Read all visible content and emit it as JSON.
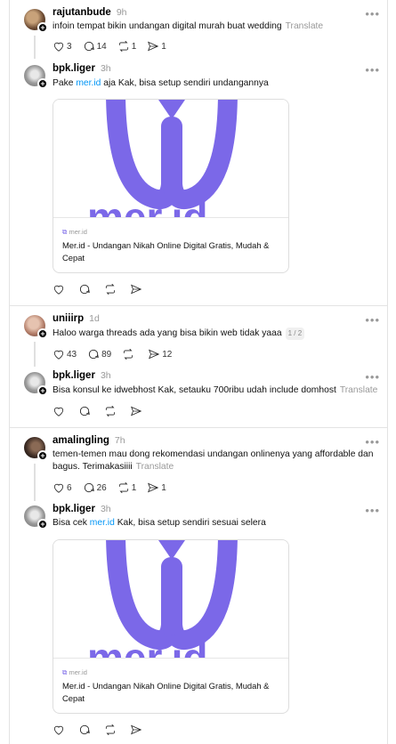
{
  "threads": [
    {
      "op": {
        "username": "rajutanbude",
        "time": "9h",
        "text": "infoin tempat bikin undangan digital murah buat wedding",
        "translate": "Translate",
        "likes": "3",
        "replies": "14",
        "reposts": "1",
        "shares": "1"
      },
      "reply": {
        "username": "bpk.liger",
        "time": "3h",
        "text_before": "Pake ",
        "link": "mer.id",
        "text_after": " aja Kak, bisa setup sendiri undangannya",
        "card_domain": "mer.id",
        "card_title": "Mer.id - Undangan Nikah Online Digital Gratis, Mudah & Cepat"
      }
    },
    {
      "op": {
        "username": "uniiirp",
        "time": "1d",
        "text": "Haloo warga threads ada yang bisa bikin web tidak yaaa",
        "page_indicator": "1 / 2",
        "likes": "43",
        "replies": "89",
        "shares": "12"
      },
      "reply": {
        "username": "bpk.liger",
        "time": "3h",
        "text": "Bisa konsul ke idwebhost Kak, setauku 700ribu udah include domhost",
        "translate": "Translate"
      }
    },
    {
      "op": {
        "username": "amalingling",
        "time": "7h",
        "text": "temen-temen mau dong rekomendasi undangan onlinenya yang affordable dan bagus. Terimakasiiii",
        "translate": "Translate",
        "likes": "6",
        "replies": "26",
        "reposts": "1",
        "shares": "1"
      },
      "reply": {
        "username": "bpk.liger",
        "time": "3h",
        "text_before": "Bisa cek ",
        "link": "mer.id",
        "text_after": " Kak, bisa setup sendiri sesuai selera",
        "card_domain": "mer.id",
        "card_title": "Mer.id - Undangan Nikah Online Digital Gratis, Mudah & Cepat"
      }
    }
  ],
  "more_icon": "more-icon",
  "colors": {
    "link": "#0095f6",
    "brand": "#7b68e8",
    "muted": "#999999"
  }
}
